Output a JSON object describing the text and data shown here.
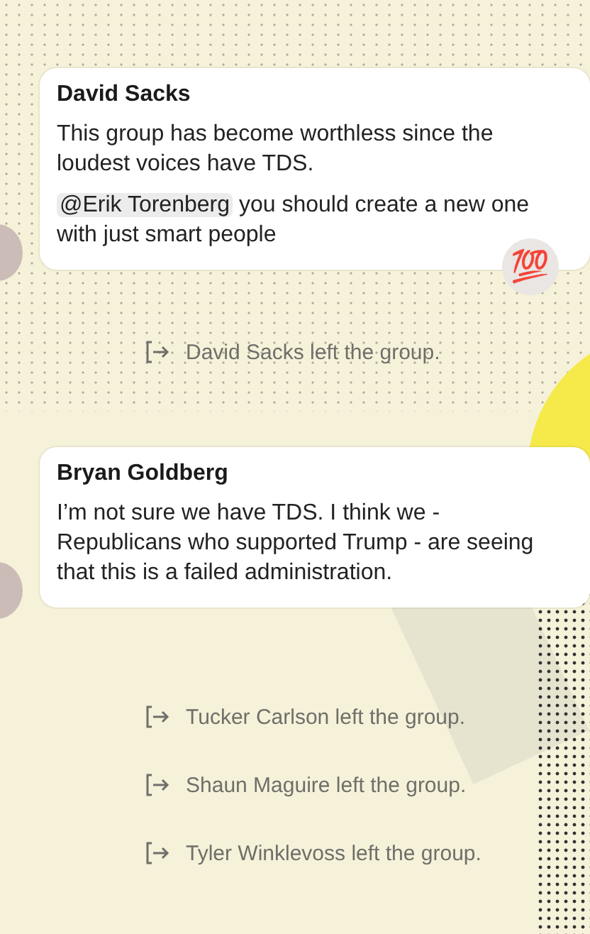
{
  "items": [
    {
      "kind": "message",
      "sender": "David Sacks",
      "paragraphs": [
        {
          "text": "This group has become worthless since the loudest voices have TDS."
        },
        {
          "mention": "@Erik Torenberg",
          "text": "you should create a new one with just smart people"
        }
      ],
      "reaction": "💯"
    },
    {
      "kind": "system",
      "text": "David Sacks left the group."
    },
    {
      "kind": "message",
      "sender": "Bryan Goldberg",
      "paragraphs": [
        {
          "text": "I’m not sure we have TDS. I think we - Republicans who supported Trump - are seeing that this is a failed administration."
        }
      ]
    },
    {
      "kind": "system",
      "text": "Tucker Carlson left the group."
    },
    {
      "kind": "system",
      "text": "Shaun Maguire left the group."
    },
    {
      "kind": "system",
      "text": "Tyler Winklevoss left the group."
    }
  ]
}
